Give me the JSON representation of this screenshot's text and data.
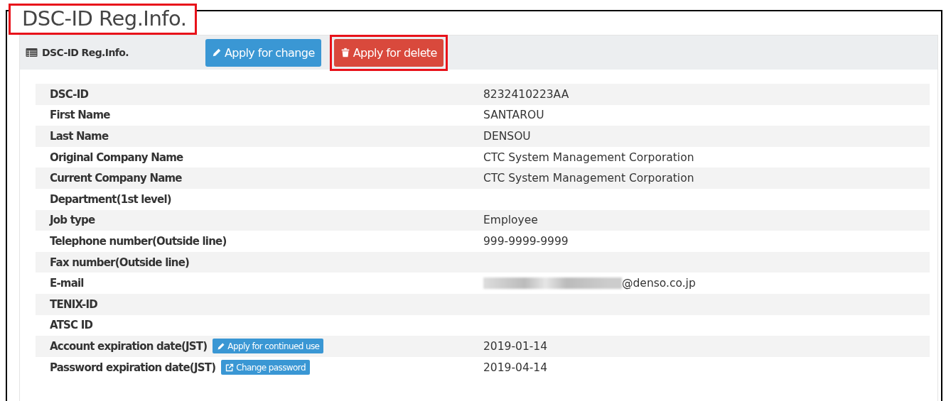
{
  "page_title": {
    "text": "DSC-ID Reg.Info.",
    "highlighted": true
  },
  "panel": {
    "title": "DSC-ID Reg.Info.",
    "buttons": [
      {
        "label": "Apply for change",
        "kind": "edit",
        "highlighted": false
      },
      {
        "label": "Apply for delete",
        "kind": "delete",
        "highlighted": true
      }
    ]
  },
  "rows": [
    {
      "label": "DSC-ID",
      "value": "8232410223AA"
    },
    {
      "label": "First Name",
      "value": "SANTAROU"
    },
    {
      "label": "Last Name",
      "value": "DENSOU"
    },
    {
      "label": "Original Company Name",
      "value": "CTC System Management Corporation"
    },
    {
      "label": "Current Company Name",
      "value": "CTC System Management Corporation"
    },
    {
      "label": "Department(1st level)"
    },
    {
      "label": "Job type",
      "value": "Employee"
    },
    {
      "label": "Telephone number(Outside line)",
      "value": "999-9999-9999"
    },
    {
      "label": "Fax number(Outside line)"
    },
    {
      "label": "E-mail",
      "value": "@denso.co.jp",
      "redacted": true
    },
    {
      "label": "TENIX-ID"
    },
    {
      "label": "ATSC ID"
    },
    {
      "label": "Account expiration date(JST)",
      "value": "2019-01-14",
      "action": {
        "label": "Apply for continued use",
        "kind": "edit"
      }
    },
    {
      "label": "Password expiration date(JST)",
      "value": "2019-04-14",
      "action": {
        "label": "Change password",
        "kind": "external"
      }
    }
  ]
}
